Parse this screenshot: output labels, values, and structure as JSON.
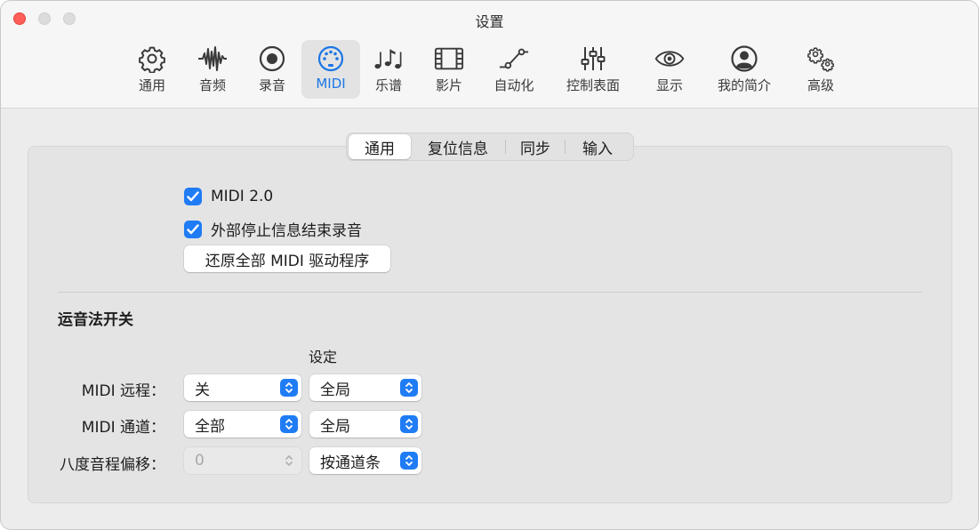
{
  "window": {
    "title": "设置"
  },
  "toolbar": {
    "items": [
      {
        "label": "通用",
        "icon": "gear-icon"
      },
      {
        "label": "音频",
        "icon": "waveform-icon"
      },
      {
        "label": "录音",
        "icon": "record-icon"
      },
      {
        "label": "MIDI",
        "icon": "midi-connector-icon",
        "active": true
      },
      {
        "label": "乐谱",
        "icon": "music-notes-icon"
      },
      {
        "label": "影片",
        "icon": "film-icon"
      },
      {
        "label": "自动化",
        "icon": "automation-curve-icon"
      },
      {
        "label": "控制表面",
        "icon": "sliders-icon"
      },
      {
        "label": "显示",
        "icon": "eye-icon"
      },
      {
        "label": "我的简介",
        "icon": "person-circle-icon"
      },
      {
        "label": "高级",
        "icon": "gears-icon"
      }
    ]
  },
  "tabs": {
    "items": [
      {
        "label": "通用",
        "selected": true
      },
      {
        "label": "复位信息"
      },
      {
        "label": "同步"
      },
      {
        "label": "输入"
      }
    ]
  },
  "general": {
    "midi2_label": "MIDI 2.0",
    "midi2_checked": true,
    "stop_label": "外部停止信息结束录音",
    "stop_checked": true,
    "reset_button": "还原全部 MIDI 驱动程序"
  },
  "articulation": {
    "title": "运音法开关",
    "setting_header": "设定",
    "rows": [
      {
        "label": "MIDI 远程：",
        "value": "关",
        "setting": "全局",
        "enabled": true
      },
      {
        "label": "MIDI 通道：",
        "value": "全部",
        "setting": "全局",
        "enabled": true
      },
      {
        "label": "八度音程偏移：",
        "value": "0",
        "setting": "按通道条",
        "enabled": false
      }
    ]
  },
  "colors": {
    "accent": "#1f7cf5",
    "close": "#fe5f57"
  }
}
